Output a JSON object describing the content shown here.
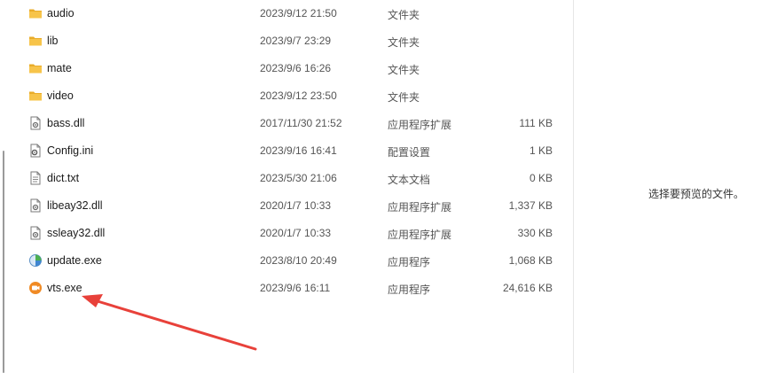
{
  "files": [
    {
      "name": "audio",
      "date": "2023/9/12 21:50",
      "type": "文件夹",
      "size": "",
      "icon": "folder-icon"
    },
    {
      "name": "lib",
      "date": "2023/9/7 23:29",
      "type": "文件夹",
      "size": "",
      "icon": "folder-icon"
    },
    {
      "name": "mate",
      "date": "2023/9/6 16:26",
      "type": "文件夹",
      "size": "",
      "icon": "folder-icon"
    },
    {
      "name": "video",
      "date": "2023/9/12 23:50",
      "type": "文件夹",
      "size": "",
      "icon": "folder-icon"
    },
    {
      "name": "bass.dll",
      "date": "2017/11/30 21:52",
      "type": "应用程序扩展",
      "size": "111 KB",
      "icon": "dll-icon"
    },
    {
      "name": "Config.ini",
      "date": "2023/9/16 16:41",
      "type": "配置设置",
      "size": "1 KB",
      "icon": "settings-file-icon"
    },
    {
      "name": "dict.txt",
      "date": "2023/5/30 21:06",
      "type": "文本文档",
      "size": "0 KB",
      "icon": "text-file-icon"
    },
    {
      "name": "libeay32.dll",
      "date": "2020/1/7 10:33",
      "type": "应用程序扩展",
      "size": "1,337 KB",
      "icon": "dll-icon"
    },
    {
      "name": "ssleay32.dll",
      "date": "2020/1/7 10:33",
      "type": "应用程序扩展",
      "size": "330 KB",
      "icon": "dll-icon"
    },
    {
      "name": "update.exe",
      "date": "2023/8/10 20:49",
      "type": "应用程序",
      "size": "1,068 KB",
      "icon": "update-app-icon"
    },
    {
      "name": "vts.exe",
      "date": "2023/9/6 16:11",
      "type": "应用程序",
      "size": "24,616 KB",
      "icon": "vts-app-icon"
    }
  ],
  "preview": {
    "message": "选择要预览的文件。"
  },
  "colors": {
    "folder": "#f7c44a",
    "folder_dark": "#e9ac2a",
    "arrow": "#e8413a",
    "vts": "#f08a24"
  }
}
